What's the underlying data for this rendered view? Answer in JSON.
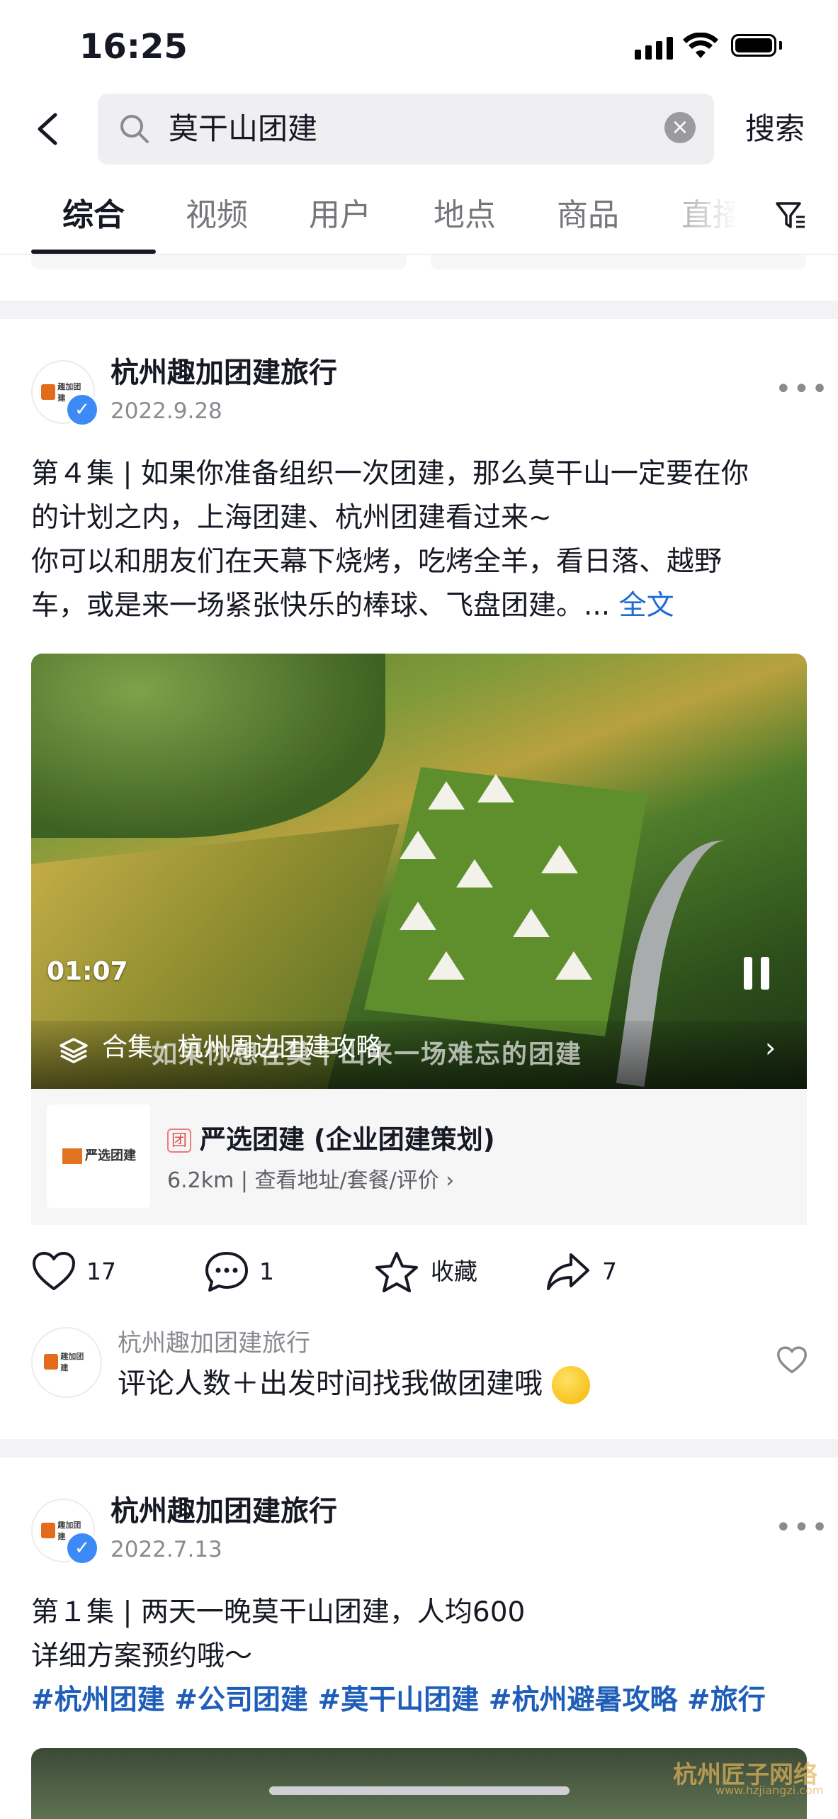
{
  "status_bar": {
    "time": "16:25"
  },
  "search": {
    "query": "莫干山团建",
    "button_label": "搜索"
  },
  "tabs": [
    {
      "label": "综合",
      "active": true
    },
    {
      "label": "视频"
    },
    {
      "label": "用户"
    },
    {
      "label": "地点"
    },
    {
      "label": "商品"
    },
    {
      "label": "直播"
    }
  ],
  "post1": {
    "author": "杭州趣加团建旅行",
    "date": "2022.9.28",
    "line1": "第４集 | 如果你准备组织一次团建，那么莫干山一定要在你",
    "line2": "的计划之内，上海团建、杭州团建看过来~",
    "line3": "你可以和朋友们在天幕下烧烤，吃烤全羊，看日落、越野",
    "line4": "车，或是来一场紧张快乐的棒球、飞盘团建。... ",
    "more_label": "全文",
    "video": {
      "time": "01:07",
      "collection": "合集 · 杭州周边团建攻略",
      "subtitle": "如果你想在莫干山来一场难忘的团建"
    },
    "poi": {
      "badge": "团",
      "title": "严选团建 (企业团建策划)",
      "subtitle": "6.2km | 查看地址/套餐/评价 ›",
      "logo_text": "严选团建"
    },
    "actions": {
      "likes": "17",
      "comments": "1",
      "favorite_label": "收藏",
      "shares": "7"
    },
    "comment": {
      "author": "杭州趣加团建旅行",
      "text": "评论人数＋出发时间找我做团建哦"
    }
  },
  "post2": {
    "author": "杭州趣加团建旅行",
    "date": "2022.7.13",
    "line1": "第１集 | 两天一晚莫干山团建，人均600",
    "line2": "详细方案预约哦～",
    "hashtags": "#杭州团建 #公司团建 #莫干山团建 #杭州避暑攻略 #旅行"
  },
  "watermark": {
    "text": "杭州匠子网络",
    "url": "www.hzjiangzi.com"
  },
  "colors": {
    "link": "#1e6bd6",
    "hashtag": "#1e5db8",
    "verified": "#3d8af7"
  }
}
